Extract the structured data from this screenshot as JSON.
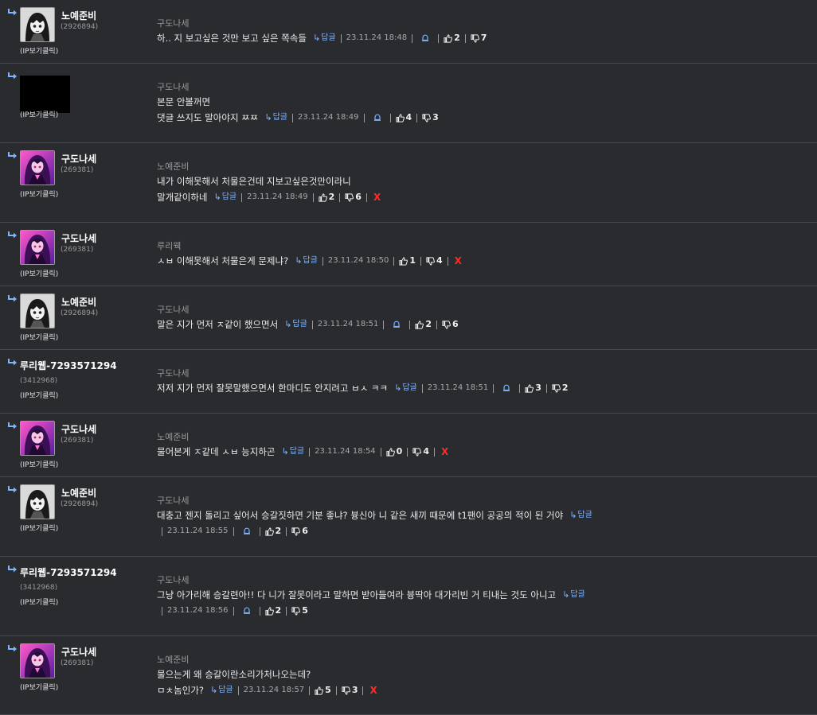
{
  "comments": [
    {
      "avatar": "avatar-girl-bw",
      "nickname": "노예준비",
      "user_id": "(2926894)",
      "ip_label": "(IP보기클릭)",
      "reply_to": "구도나세",
      "lines": [
        "하.. 지 보고싶은 것만 보고 싶은 쪽속들"
      ],
      "reply_label": "답글",
      "date": "23.11.24 18:48",
      "bell": true,
      "likes": "2",
      "dislikes": "7",
      "delete": false
    },
    {
      "avatar": "avatar-hidden",
      "nickname": "",
      "user_id": "",
      "ip_label": "(IP보기클릭)",
      "reply_to": "구도나세",
      "lines": [
        "본문 안볼꺼면",
        "댓글 쓰지도 말아야지 ㅉㅉ"
      ],
      "reply_label": "답글",
      "date": "23.11.24 18:49",
      "bell": true,
      "likes": "4",
      "dislikes": "3",
      "delete": false
    },
    {
      "avatar": "avatar-anime-purple",
      "nickname": "구도나세",
      "user_id": "(269381)",
      "ip_label": "(IP보기클릭)",
      "reply_to": "노예준비",
      "lines": [
        "내가 이해못해서 처물은건데 지보고싶은것만이라니",
        "말개같이하네"
      ],
      "reply_label": "답글",
      "date": "23.11.24 18:49",
      "bell": false,
      "likes": "2",
      "dislikes": "6",
      "delete": true
    },
    {
      "avatar": "avatar-anime-purple",
      "nickname": "구도나세",
      "user_id": "(269381)",
      "ip_label": "(IP보기클릭)",
      "reply_to": "루리웩",
      "lines": [
        "ㅅㅂ 이해못해서 처물은게 문제냐?"
      ],
      "reply_label": "답글",
      "date": "23.11.24 18:50",
      "bell": false,
      "likes": "1",
      "dislikes": "4",
      "delete": true
    },
    {
      "avatar": "avatar-girl-bw",
      "nickname": "노예준비",
      "user_id": "(2926894)",
      "ip_label": "(IP보기클릭)",
      "reply_to": "구도나세",
      "lines": [
        "말은 지가 먼저 ㅈ같이 했으면서"
      ],
      "reply_label": "답글",
      "date": "23.11.24 18:51",
      "bell": true,
      "likes": "2",
      "dislikes": "6",
      "delete": false
    },
    {
      "avatar": "none",
      "nickname": "루리웹-7293571294",
      "user_id": "(3412968)",
      "ip_label": "(IP보기클릭)",
      "reply_to": "구도나세",
      "lines": [
        "저저 지가 먼저 잘못말했으면서 한마디도 안지려고 ㅂㅅ ㅋㅋ"
      ],
      "reply_label": "답글",
      "date": "23.11.24 18:51",
      "bell": true,
      "likes": "3",
      "dislikes": "2",
      "delete": false
    },
    {
      "avatar": "avatar-anime-purple",
      "nickname": "구도나세",
      "user_id": "(269381)",
      "ip_label": "(IP보기클릭)",
      "reply_to": "노예준비",
      "lines": [
        "물어본게 ㅈ같데 ㅅㅂ 능지하곤"
      ],
      "reply_label": "답글",
      "date": "23.11.24 18:54",
      "bell": false,
      "likes": "0",
      "dislikes": "4",
      "delete": true
    },
    {
      "avatar": "avatar-girl-bw",
      "nickname": "노예준비",
      "user_id": "(2926894)",
      "ip_label": "(IP보기클릭)",
      "reply_to": "구도나세",
      "lines": [
        "대충고 젠지 돌리고 싶어서 승갈짓하면 기분 좋냐? 븅신아 니 같은 새끼 때문에 t1팬이 공공의 적이 된 거야"
      ],
      "reply_label": "답글",
      "date": "23.11.24 18:55",
      "bell": true,
      "likes": "2",
      "dislikes": "6",
      "delete": false
    },
    {
      "avatar": "none",
      "nickname": "루리웹-7293571294",
      "user_id": "(3412968)",
      "ip_label": "(IP보기클릭)",
      "reply_to": "구도나세",
      "lines": [
        "그냥 아가리해 승갈련아!! 다 니가 잘못이라고 말하면 받아들여라 븅딱아 대가리빈 거 티내는 것도 아니고"
      ],
      "reply_label": "답글",
      "date": "23.11.24 18:56",
      "bell": true,
      "likes": "2",
      "dislikes": "5",
      "delete": false
    },
    {
      "avatar": "avatar-anime-purple",
      "nickname": "구도나세",
      "user_id": "(269381)",
      "ip_label": "(IP보기클릭)",
      "reply_to": "노예준비",
      "lines": [
        "물으는게 왜 승갈이란소리가처나오는데?",
        "ㅁㅊ놈인가?"
      ],
      "reply_label": "답글",
      "date": "23.11.24 18:57",
      "bell": false,
      "likes": "5",
      "dislikes": "3",
      "delete": true
    }
  ],
  "colors": {
    "background": "#2a2b2f",
    "divider": "#46474c",
    "reply_link": "#7fb4ff",
    "delete": "#ff2a2a"
  }
}
